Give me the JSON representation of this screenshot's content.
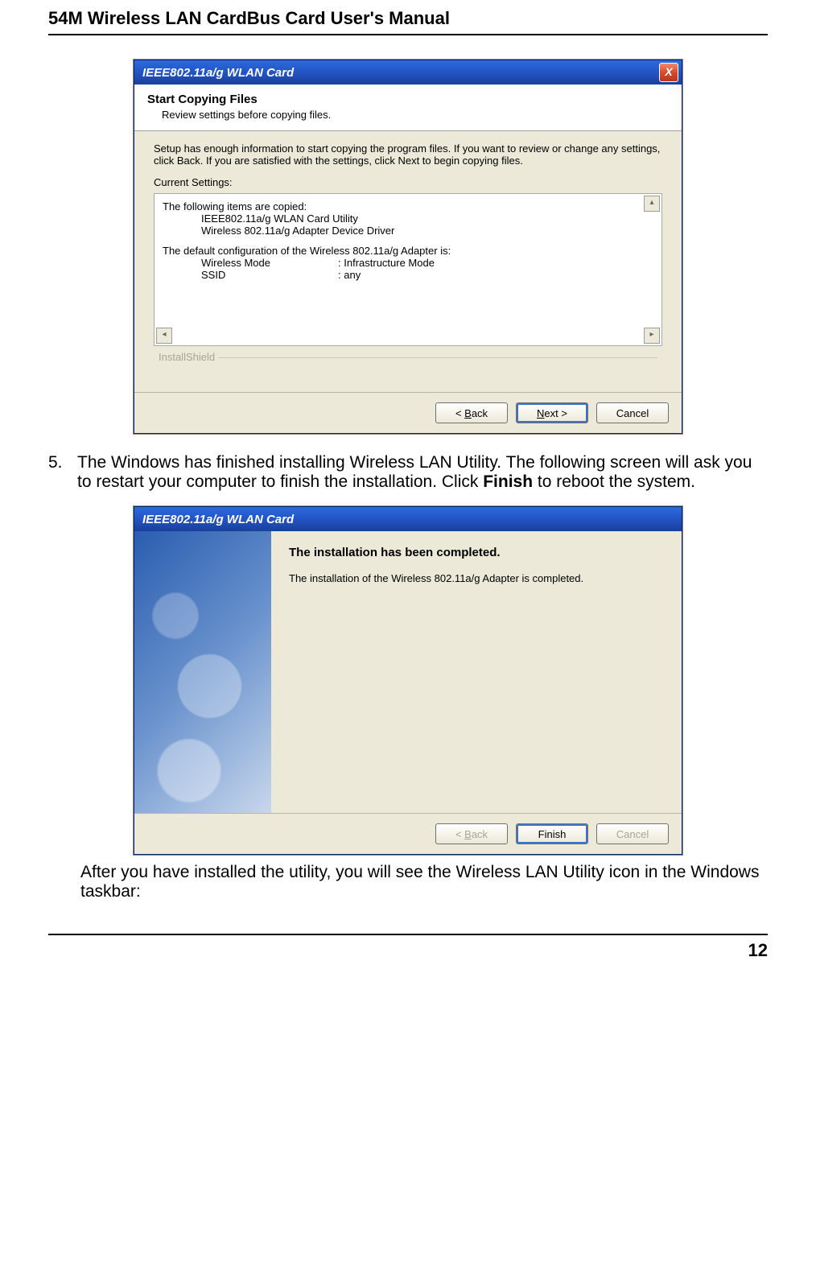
{
  "doc": {
    "header": "54M Wireless LAN CardBus Card User's Manual",
    "page_number": "12"
  },
  "step5": {
    "number": "5.",
    "text_a": "The Windows has finished installing Wireless LAN Utility. The following screen will ask you to restart your computer to finish the installation. Click ",
    "bold": "Finish",
    "text_b": " to reboot the system."
  },
  "after_text": "After you have installed the utility, you will see the Wireless LAN Utility icon in the Windows taskbar:",
  "dlg1": {
    "title": "IEEE802.11a/g WLAN Card",
    "close": "X",
    "banner_title": "Start Copying Files",
    "banner_sub": "Review settings before copying files.",
    "intro": "Setup has enough information to start copying the program files.  If you want to review or change any settings, click Back.  If you are satisfied with the settings, click Next to begin copying files.",
    "cs_label": "Current Settings:",
    "line1": "The following items are copied:",
    "item1": "IEEE802.11a/g WLAN Card Utility",
    "item2": "Wireless 802.11a/g Adapter Device Driver",
    "line2": "The default configuration of the Wireless 802.11a/g Adapter is:",
    "kv": [
      {
        "k": "Wireless Mode",
        "v": "Infrastructure Mode"
      },
      {
        "k": "SSID",
        "v": "any"
      }
    ],
    "is_legend": "InstallShield",
    "btn_back_pre": "< ",
    "btn_back_u": "B",
    "btn_back_post": "ack",
    "btn_next_u": "N",
    "btn_next_post": "ext >",
    "btn_cancel": "Cancel"
  },
  "dlg2": {
    "title": "IEEE802.11a/g WLAN Card",
    "heading": "The installation has been completed.",
    "body": "The installation of the Wireless 802.11a/g Adapter is completed.",
    "btn_back_pre": "< ",
    "btn_back_u": "B",
    "btn_back_post": "ack",
    "btn_finish": "Finish",
    "btn_cancel": "Cancel"
  }
}
